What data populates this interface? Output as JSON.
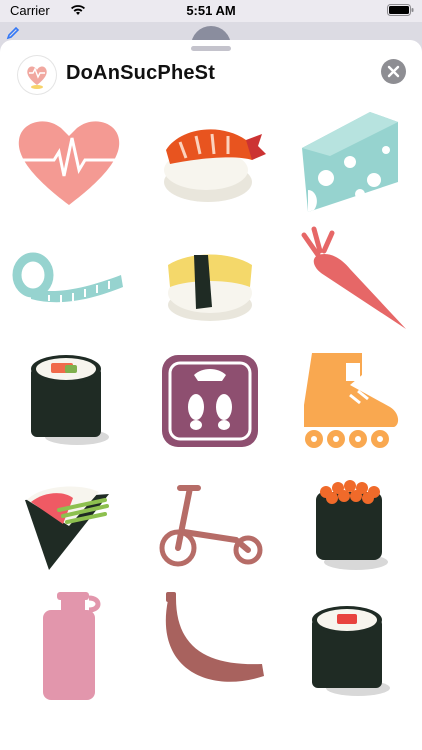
{
  "status_bar": {
    "carrier": "Carrier",
    "time": "5:51 AM"
  },
  "header": {
    "title": "DoAnSucPheSt"
  },
  "icons": {
    "wifi": "wifi-icon",
    "battery": "battery-icon",
    "close": "close-icon",
    "edit": "pencil-icon"
  },
  "stickers": [
    {
      "name": "heart-pulse-sticker"
    },
    {
      "name": "shrimp-sushi-sticker"
    },
    {
      "name": "cheese-sticker"
    },
    {
      "name": "measuring-tape-sticker"
    },
    {
      "name": "tamago-sushi-sticker"
    },
    {
      "name": "carrot-sticker"
    },
    {
      "name": "salmon-maki-roll-sticker"
    },
    {
      "name": "bathroom-scale-sticker"
    },
    {
      "name": "inline-skate-sticker"
    },
    {
      "name": "temaki-hand-roll-sticker"
    },
    {
      "name": "kick-scooter-sticker"
    },
    {
      "name": "ikura-gunkan-sticker"
    },
    {
      "name": "water-bottle-sticker"
    },
    {
      "name": "banana-sticker"
    },
    {
      "name": "tuna-maki-roll-sticker"
    }
  ],
  "colors": {
    "heart": "#f49a93",
    "cheese": "#96d3cf",
    "carrot": "#e66767",
    "scale": "#8e4f70",
    "skate": "#f9a850",
    "scooter": "#b66c67",
    "bottle": "#e296ac",
    "banana": "#a8625e",
    "accent": "#3478f6"
  }
}
